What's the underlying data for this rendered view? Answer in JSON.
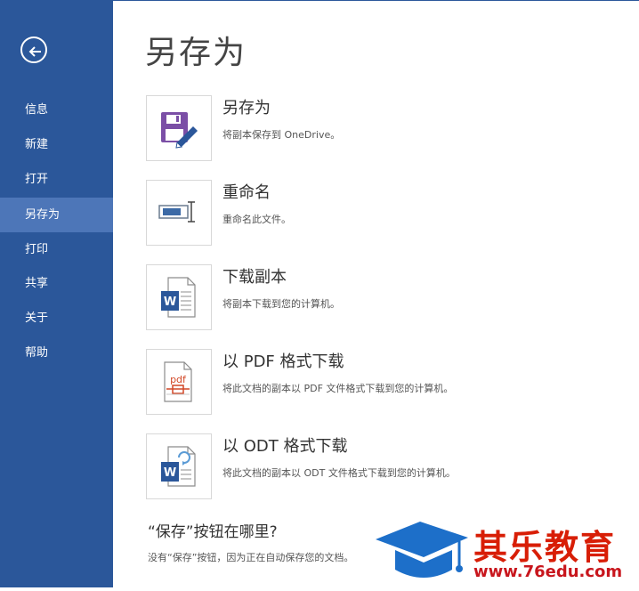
{
  "sidebar": {
    "back_icon": "back-arrow-icon",
    "items": [
      {
        "label": "信息"
      },
      {
        "label": "新建"
      },
      {
        "label": "打开"
      },
      {
        "label": "另存为"
      },
      {
        "label": "打印"
      },
      {
        "label": "共享"
      },
      {
        "label": "关于"
      },
      {
        "label": "帮助"
      }
    ],
    "active_index": 3
  },
  "main": {
    "title": "另存为",
    "options": [
      {
        "title": "另存为",
        "desc": "将副本保存到 OneDrive。",
        "icon": "save-disk-icon"
      },
      {
        "title": "重命名",
        "desc": "重命名此文件。",
        "icon": "rename-icon"
      },
      {
        "title": "下载副本",
        "desc": "将副本下载到您的计算机。",
        "icon": "word-document-icon"
      },
      {
        "title": "以 PDF 格式下载",
        "desc": "将此文档的副本以 PDF 文件格式下载到您的计算机。",
        "icon": "pdf-document-icon"
      },
      {
        "title": "以 ODT 格式下载",
        "desc": "将此文档的副本以 ODT 文件格式下载到您的计算机。",
        "icon": "odt-document-icon"
      }
    ],
    "faq": {
      "title": "“保存”按钮在哪里?",
      "desc": "没有“保存”按钮，因为正在自动保存您的文档。"
    }
  },
  "watermark": {
    "brand": "其乐教育",
    "url": "www.76edu.com"
  },
  "colors": {
    "sidebar": "#2b579a",
    "sidebar_active": "#4d76b8",
    "save_icon": "#7b4fa6",
    "word_blue": "#2b579a",
    "pdf_red": "#d24726",
    "watermark_red": "#d81e06",
    "watermark_blue": "#1d6fc9"
  }
}
